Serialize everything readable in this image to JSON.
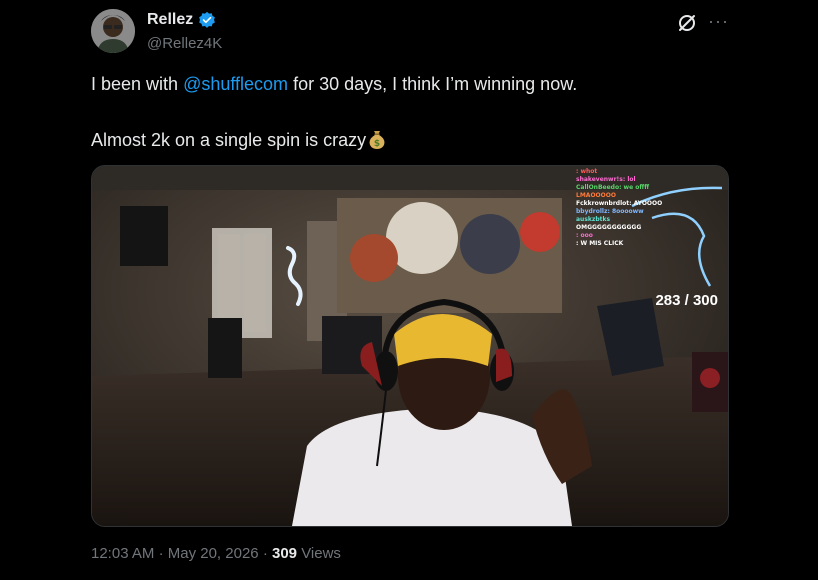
{
  "author": {
    "display_name": "Rellez",
    "handle": "@Rellez4K",
    "verified": true
  },
  "icons": {
    "verified": "verified-badge-icon",
    "grok": "grok-icon",
    "more": "more-options-icon",
    "emoji": "money-bag-emoji"
  },
  "tweet": {
    "line1_before": "I been with ",
    "mention": "@shufflecom",
    "line1_after": " for 30 days, I think I’m winning now.",
    "line2": "Almost 2k on a single spin is crazy"
  },
  "media": {
    "counter": "283 / 300",
    "chat_lines": [
      ": whot",
      "shakevenwr!s: lol",
      "CallOnBeedo: we offff",
      "LMAOOOOO",
      "Fckkrownbrdlot: AYOOOO",
      "bbydrollz: 8ooooww",
      "auskzbtks",
      "OMGGGGGGGGGGG",
      ": ooo",
      ": W MIS CLICK"
    ]
  },
  "meta": {
    "time": "12:03 AM",
    "separator": "·",
    "date": "May 20, 2026",
    "views_count": "309",
    "views_label": "Views"
  },
  "colors": {
    "background": "#000000",
    "text": "#e7e9ea",
    "secondary": "#71767b",
    "accent": "#1d9bf0"
  }
}
